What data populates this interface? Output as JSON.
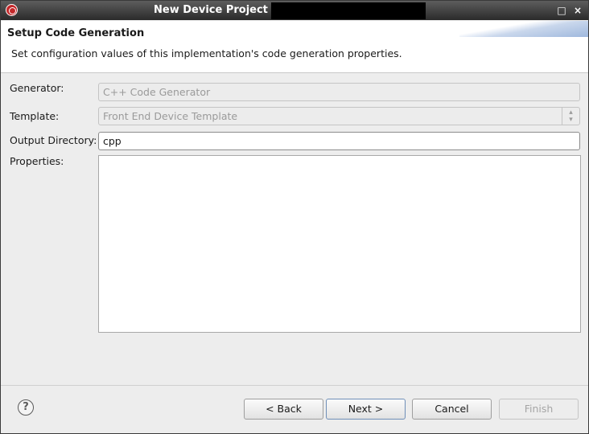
{
  "window": {
    "title": "New Device Project",
    "maximize_glyph": "□",
    "close_glyph": "×"
  },
  "header": {
    "title": "Setup Code Generation",
    "description": "Set configuration values of this implementation's code generation properties."
  },
  "form": {
    "generator": {
      "label": "Generator:",
      "value": "C++ Code Generator"
    },
    "template": {
      "label": "Template:",
      "value": "Front End Device Template"
    },
    "output_directory": {
      "label": "Output Directory:",
      "value": "cpp"
    },
    "properties": {
      "label": "Properties:"
    }
  },
  "footer": {
    "help_glyph": "?",
    "back_label": "< Back",
    "next_label": "Next >",
    "cancel_label": "Cancel",
    "finish_label": "Finish"
  }
}
